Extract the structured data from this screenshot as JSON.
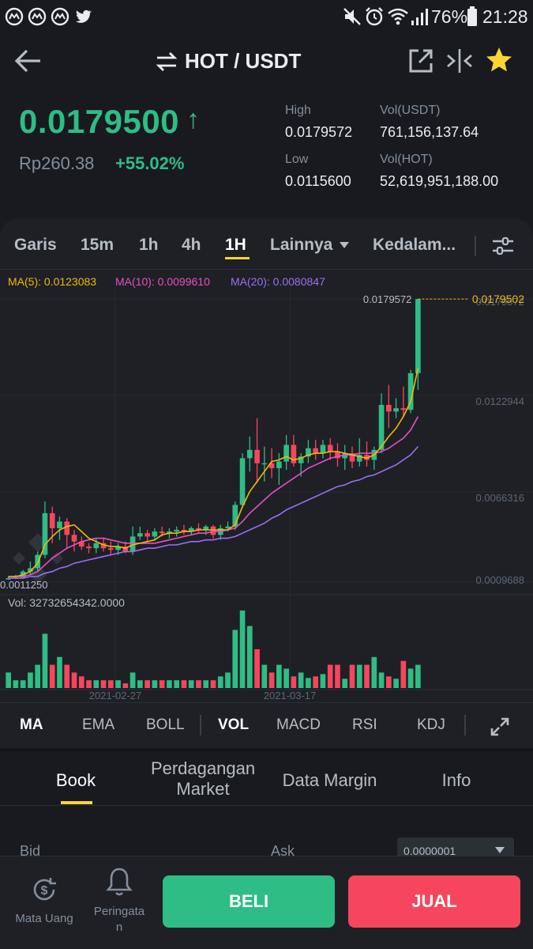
{
  "status_bar": {
    "app_icons": [
      "coinmarketcap-icon",
      "coinmarketcap-icon",
      "coinmarketcap-icon",
      "twitter-icon"
    ],
    "battery": "76%",
    "time": "21:28"
  },
  "header": {
    "pair": "HOT / USDT"
  },
  "ticker": {
    "price": "0.0179500",
    "price_arrow": "↑",
    "idr_price": "Rp260.38",
    "change": "+55.02%",
    "high_label": "High",
    "high_value": "0.0179572",
    "low_label": "Low",
    "low_value": "0.0115600",
    "vol_usdt_label": "Vol(USDT)",
    "vol_usdt_value": "761,156,137.64",
    "vol_hot_label": "Vol(HOT)",
    "vol_hot_value": "52,619,951,188.00"
  },
  "timeframes": {
    "line": "Garis",
    "m15": "15m",
    "h1a": "1h",
    "h4": "4h",
    "h1b": "1H",
    "more": "Lainnya",
    "depth": "Kedalam..."
  },
  "chart_data": {
    "type": "candlestick",
    "indicators": {
      "ma5_label": "MA(5): 0.0123083",
      "ma10_label": "MA(10): 0.0099610",
      "ma20_label": "MA(20): 0.0080847"
    },
    "y_ticks": [
      "0.0179572",
      "0.0122944",
      "0.0066316",
      "0.0009688"
    ],
    "high_marker": "0.0179572",
    "last_price_marker": "0.0179502",
    "low_marker": "0.0011250",
    "volume_label": "Vol: 32732654342.0000",
    "x_ticks": [
      "2021-02-27",
      "2021-03-17"
    ],
    "ylim": [
      0.0009688,
      0.0179572
    ],
    "candles": [
      {
        "o": 0.00115,
        "h": 0.0013,
        "l": 0.0011,
        "c": 0.0012
      },
      {
        "o": 0.0012,
        "h": 0.0014,
        "l": 0.00115,
        "c": 0.00125
      },
      {
        "o": 0.00125,
        "h": 0.0017,
        "l": 0.0012,
        "c": 0.0016
      },
      {
        "o": 0.0016,
        "h": 0.0022,
        "l": 0.0014,
        "c": 0.0018
      },
      {
        "o": 0.0018,
        "h": 0.0028,
        "l": 0.0016,
        "c": 0.0026
      },
      {
        "o": 0.0026,
        "h": 0.0058,
        "l": 0.0024,
        "c": 0.0051
      },
      {
        "o": 0.0051,
        "h": 0.0055,
        "l": 0.0033,
        "c": 0.0042
      },
      {
        "o": 0.0042,
        "h": 0.0049,
        "l": 0.0035,
        "c": 0.0046
      },
      {
        "o": 0.0046,
        "h": 0.0048,
        "l": 0.003,
        "c": 0.0038
      },
      {
        "o": 0.0038,
        "h": 0.0041,
        "l": 0.0028,
        "c": 0.0034
      },
      {
        "o": 0.0034,
        "h": 0.0037,
        "l": 0.0029,
        "c": 0.0031
      },
      {
        "o": 0.0031,
        "h": 0.0033,
        "l": 0.0027,
        "c": 0.003
      },
      {
        "o": 0.003,
        "h": 0.0036,
        "l": 0.0027,
        "c": 0.0033
      },
      {
        "o": 0.0033,
        "h": 0.0036,
        "l": 0.0028,
        "c": 0.003
      },
      {
        "o": 0.003,
        "h": 0.0034,
        "l": 0.0026,
        "c": 0.0029
      },
      {
        "o": 0.0029,
        "h": 0.0033,
        "l": 0.0026,
        "c": 0.0031
      },
      {
        "o": 0.0031,
        "h": 0.0034,
        "l": 0.0027,
        "c": 0.0028
      },
      {
        "o": 0.0028,
        "h": 0.0043,
        "l": 0.0026,
        "c": 0.0037
      },
      {
        "o": 0.0037,
        "h": 0.0043,
        "l": 0.0035,
        "c": 0.0039
      },
      {
        "o": 0.0039,
        "h": 0.0041,
        "l": 0.0034,
        "c": 0.0037
      },
      {
        "o": 0.0037,
        "h": 0.0042,
        "l": 0.0035,
        "c": 0.004
      },
      {
        "o": 0.004,
        "h": 0.0043,
        "l": 0.0037,
        "c": 0.0039
      },
      {
        "o": 0.0039,
        "h": 0.0042,
        "l": 0.0036,
        "c": 0.004
      },
      {
        "o": 0.004,
        "h": 0.0043,
        "l": 0.0037,
        "c": 0.0041
      },
      {
        "o": 0.0041,
        "h": 0.0044,
        "l": 0.0038,
        "c": 0.004
      },
      {
        "o": 0.004,
        "h": 0.0043,
        "l": 0.0038,
        "c": 0.0042
      },
      {
        "o": 0.0042,
        "h": 0.0045,
        "l": 0.0039,
        "c": 0.0041
      },
      {
        "o": 0.0041,
        "h": 0.0044,
        "l": 0.0038,
        "c": 0.0043
      },
      {
        "o": 0.0043,
        "h": 0.0044,
        "l": 0.0036,
        "c": 0.0038
      },
      {
        "o": 0.0038,
        "h": 0.0044,
        "l": 0.0035,
        "c": 0.0042
      },
      {
        "o": 0.0042,
        "h": 0.0046,
        "l": 0.004,
        "c": 0.0043
      },
      {
        "o": 0.0043,
        "h": 0.0058,
        "l": 0.0041,
        "c": 0.0056
      },
      {
        "o": 0.0056,
        "h": 0.0087,
        "l": 0.0054,
        "c": 0.0084
      },
      {
        "o": 0.0084,
        "h": 0.0097,
        "l": 0.0076,
        "c": 0.0089
      },
      {
        "o": 0.0089,
        "h": 0.0108,
        "l": 0.0069,
        "c": 0.0081
      },
      {
        "o": 0.0081,
        "h": 0.0091,
        "l": 0.007,
        "c": 0.0081
      },
      {
        "o": 0.0081,
        "h": 0.009,
        "l": 0.0072,
        "c": 0.0078
      },
      {
        "o": 0.0078,
        "h": 0.0087,
        "l": 0.0068,
        "c": 0.0082
      },
      {
        "o": 0.0082,
        "h": 0.0098,
        "l": 0.0077,
        "c": 0.0092
      },
      {
        "o": 0.0092,
        "h": 0.0098,
        "l": 0.0079,
        "c": 0.0081
      },
      {
        "o": 0.0081,
        "h": 0.0087,
        "l": 0.0073,
        "c": 0.0085
      },
      {
        "o": 0.0085,
        "h": 0.0095,
        "l": 0.0081,
        "c": 0.009
      },
      {
        "o": 0.009,
        "h": 0.0095,
        "l": 0.0083,
        "c": 0.0087
      },
      {
        "o": 0.0087,
        "h": 0.0095,
        "l": 0.0084,
        "c": 0.0092
      },
      {
        "o": 0.0092,
        "h": 0.0096,
        "l": 0.0083,
        "c": 0.0088
      },
      {
        "o": 0.0088,
        "h": 0.0093,
        "l": 0.0079,
        "c": 0.0084
      },
      {
        "o": 0.0084,
        "h": 0.0092,
        "l": 0.0077,
        "c": 0.0087
      },
      {
        "o": 0.0087,
        "h": 0.0091,
        "l": 0.0078,
        "c": 0.0082
      },
      {
        "o": 0.0082,
        "h": 0.0096,
        "l": 0.0079,
        "c": 0.0086
      },
      {
        "o": 0.0086,
        "h": 0.0094,
        "l": 0.0079,
        "c": 0.0083
      },
      {
        "o": 0.0083,
        "h": 0.0091,
        "l": 0.0077,
        "c": 0.0089
      },
      {
        "o": 0.0089,
        "h": 0.0123,
        "l": 0.0087,
        "c": 0.0116
      },
      {
        "o": 0.0116,
        "h": 0.0128,
        "l": 0.0102,
        "c": 0.0112
      },
      {
        "o": 0.0112,
        "h": 0.012,
        "l": 0.0108,
        "c": 0.0114
      },
      {
        "o": 0.0114,
        "h": 0.0127,
        "l": 0.0109,
        "c": 0.0113
      },
      {
        "o": 0.0113,
        "h": 0.0137,
        "l": 0.0111,
        "c": 0.0135
      },
      {
        "o": 0.0135,
        "h": 0.0179572,
        "l": 0.0125,
        "c": 0.01795
      }
    ],
    "volume": [
      2,
      1,
      1,
      2,
      3,
      7,
      3,
      4,
      3,
      2,
      1.5,
      1,
      1,
      1,
      1,
      1,
      0.6,
      2,
      1,
      1,
      1,
      1,
      1,
      1,
      1,
      1,
      1,
      1,
      1,
      1.5,
      2,
      7.5,
      10,
      8,
      5,
      3,
      2,
      3,
      2.5,
      1.5,
      2,
      1.3,
      1.5,
      1.8,
      3,
      3,
      1.2,
      3,
      3,
      3,
      4,
      2,
      1.5,
      1.2,
      3.5,
      2.5,
      3
    ],
    "ma5": [
      0.0013,
      0.0013,
      0.0014,
      0.0016,
      0.0021,
      0.0032,
      0.0037,
      0.0041,
      0.0043,
      0.0044,
      0.004,
      0.0036,
      0.0034,
      0.0032,
      0.0031,
      0.0031,
      0.003,
      0.0032,
      0.0033,
      0.0034,
      0.0035,
      0.0038,
      0.0039,
      0.0039,
      0.004,
      0.004,
      0.0041,
      0.0041,
      0.0041,
      0.0041,
      0.0041,
      0.0044,
      0.0055,
      0.0064,
      0.007,
      0.0076,
      0.0082,
      0.0083,
      0.0085,
      0.0083,
      0.0084,
      0.0086,
      0.0087,
      0.0087,
      0.0088,
      0.0088,
      0.0087,
      0.0086,
      0.0085,
      0.0084,
      0.0086,
      0.0091,
      0.0097,
      0.0102,
      0.0109,
      0.0118,
      0.0138
    ],
    "ma10": [
      0.0013,
      0.0013,
      0.0013,
      0.0014,
      0.0016,
      0.002,
      0.0024,
      0.0027,
      0.003,
      0.0032,
      0.0034,
      0.0035,
      0.0036,
      0.0036,
      0.0035,
      0.0034,
      0.0033,
      0.0033,
      0.0033,
      0.0033,
      0.0033,
      0.0034,
      0.0035,
      0.0036,
      0.0037,
      0.0038,
      0.0039,
      0.0039,
      0.004,
      0.004,
      0.0041,
      0.0042,
      0.0046,
      0.0051,
      0.0055,
      0.0059,
      0.0063,
      0.0066,
      0.0069,
      0.0072,
      0.0075,
      0.0078,
      0.008,
      0.0082,
      0.0084,
      0.0085,
      0.0086,
      0.0086,
      0.0087,
      0.0087,
      0.0087,
      0.0088,
      0.009,
      0.0093,
      0.0096,
      0.0101,
      0.0109
    ],
    "ma20": [
      0.0012,
      0.0012,
      0.0012,
      0.0013,
      0.0013,
      0.0015,
      0.0016,
      0.0018,
      0.0019,
      0.0021,
      0.0022,
      0.0023,
      0.0024,
      0.0025,
      0.0026,
      0.0027,
      0.0028,
      0.0028,
      0.0029,
      0.003,
      0.003,
      0.0031,
      0.0032,
      0.0032,
      0.0033,
      0.0034,
      0.0034,
      0.0035,
      0.0035,
      0.0036,
      0.0036,
      0.0037,
      0.0039,
      0.0041,
      0.0043,
      0.0045,
      0.0048,
      0.005,
      0.0053,
      0.0055,
      0.0057,
      0.0059,
      0.0061,
      0.0063,
      0.0065,
      0.0067,
      0.0068,
      0.007,
      0.0071,
      0.0073,
      0.0074,
      0.0076,
      0.0078,
      0.008,
      0.0083,
      0.0086,
      0.0091
    ],
    "colors": {
      "up": "#2ebd85",
      "down": "#f6465d",
      "ma5": "#f0b90b",
      "ma10": "#e84fc5",
      "ma20": "#9c6ef5"
    }
  },
  "indicators_bar": {
    "ma": "MA",
    "ema": "EMA",
    "boll": "BOLL",
    "vol": "VOL",
    "macd": "MACD",
    "rsi": "RSI",
    "kdj": "KDJ"
  },
  "book_tabs": {
    "book": "Book",
    "market_trades_1": "Perdagangan",
    "market_trades_2": "Market",
    "margin_data": "Data Margin",
    "info": "Info"
  },
  "order_book": {
    "bid_label": "Bid",
    "ask_label": "Ask",
    "precision_value": "0.0000001"
  },
  "bottom_bar": {
    "currency_label": "Mata Uang",
    "alert_label_1": "Peringata",
    "alert_label_2": "n",
    "buy_label": "BELI",
    "sell_label": "JUAL"
  },
  "colors": {
    "background": "#181a20",
    "panel": "#1e2026",
    "accent": "#fcd535",
    "up": "#2ebd85",
    "down": "#f6465d"
  }
}
